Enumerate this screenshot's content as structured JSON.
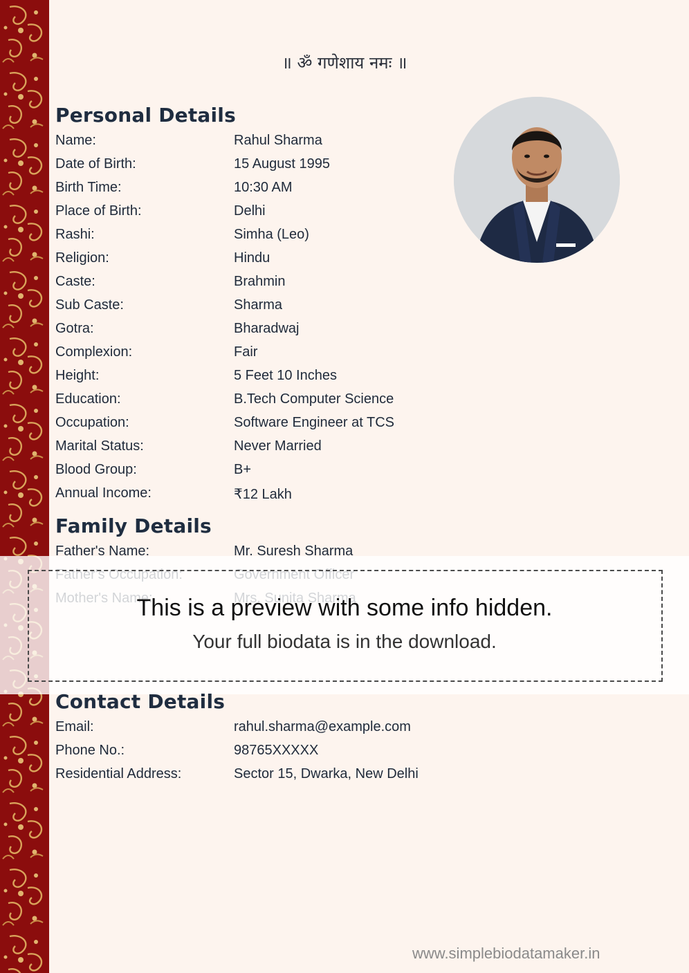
{
  "header": {
    "invocation": "॥ ॐ गणेशाय नमः ॥"
  },
  "sections": {
    "personal": {
      "title": "Personal Details",
      "rows": [
        {
          "label": "Name:",
          "value": "Rahul Sharma"
        },
        {
          "label": "Date of Birth:",
          "value": "15 August 1995"
        },
        {
          "label": "Birth Time:",
          "value": "10:30 AM"
        },
        {
          "label": "Place of Birth:",
          "value": "Delhi"
        },
        {
          "label": "Rashi:",
          "value": "Simha (Leo)"
        },
        {
          "label": "Religion:",
          "value": "Hindu"
        },
        {
          "label": "Caste:",
          "value": "Brahmin"
        },
        {
          "label": "Sub Caste:",
          "value": "Sharma"
        },
        {
          "label": "Gotra:",
          "value": "Bharadwaj"
        },
        {
          "label": "Complexion:",
          "value": "Fair"
        },
        {
          "label": "Height:",
          "value": "5 Feet 10 Inches"
        },
        {
          "label": "Education:",
          "value": "B.Tech Computer Science"
        },
        {
          "label": "Occupation:",
          "value": "Software Engineer at TCS"
        },
        {
          "label": "Marital Status:",
          "value": "Never Married"
        },
        {
          "label": "Blood Group:",
          "value": "B+"
        },
        {
          "label": "Annual Income:",
          "value": "₹12 Lakh"
        }
      ]
    },
    "family": {
      "title": "Family Details",
      "rows": [
        {
          "label": "Father's Name:",
          "value": "Mr. Suresh Sharma"
        },
        {
          "label": "Father's Occupation:",
          "value": "Government Officer"
        },
        {
          "label": "Mother's Name:",
          "value": "Mrs. Sunita Sharma"
        }
      ]
    },
    "contact": {
      "title": "Contact Details",
      "rows": [
        {
          "label": "Email:",
          "value": "rahul.sharma@example.com"
        },
        {
          "label": "Phone No.:",
          "value": "98765XXXXX"
        },
        {
          "label": "Residential Address:",
          "value": "Sector 15, Dwarka, New Delhi"
        }
      ]
    }
  },
  "preview_overlay": {
    "title": "This is a preview with some info hidden.",
    "subtitle": "Your full biodata is in the download."
  },
  "footer": {
    "website": "www.simplebiodatamaker.in"
  },
  "colors": {
    "border": "#8b0d0d",
    "motif": "#d9a35a",
    "background": "#fdf4ee",
    "heading": "#1f2d40"
  }
}
